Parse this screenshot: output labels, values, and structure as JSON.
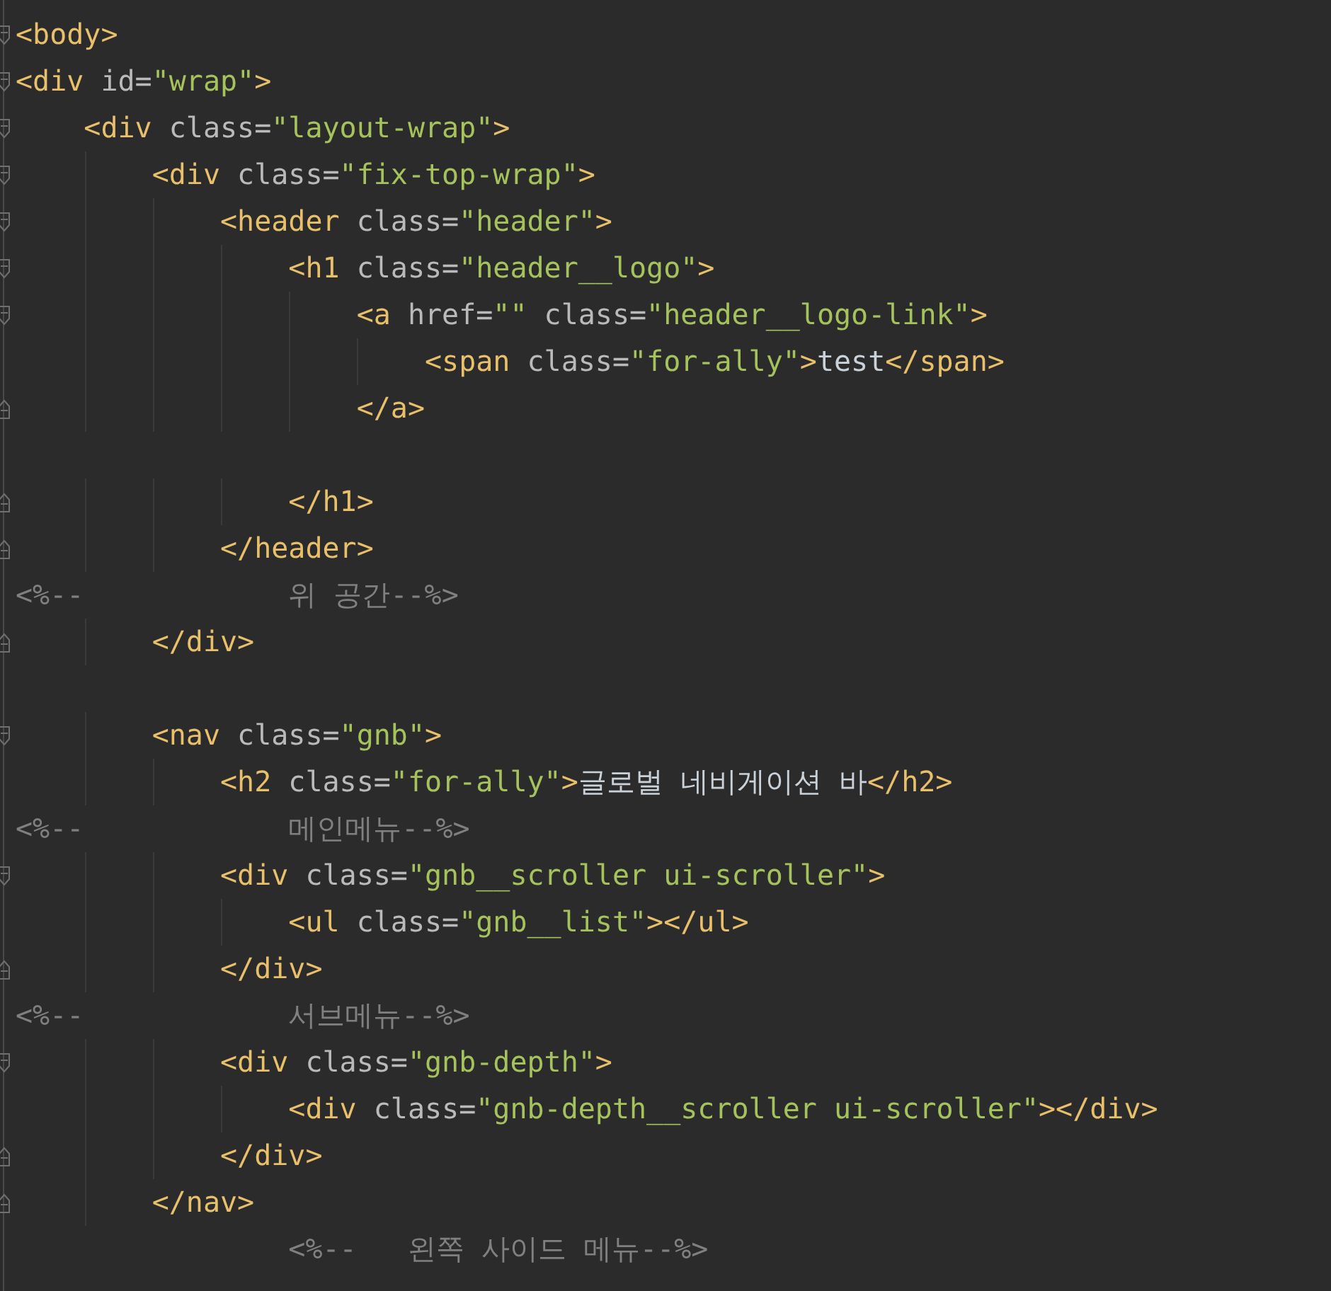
{
  "editor": {
    "lines": [
      {
        "kind": "opener",
        "segments": [
          {
            "kind": "tag",
            "text": "<body>"
          }
        ]
      },
      {
        "kind": "opener",
        "segments": [
          {
            "kind": "tag",
            "text": "<div"
          },
          {
            "kind": "attr",
            "text": " id="
          },
          {
            "kind": "string",
            "text": "\"wrap\""
          },
          {
            "kind": "tag",
            "text": ">"
          }
        ]
      },
      {
        "kind": "opener",
        "segments": [
          {
            "kind": "tag",
            "text": "    <div"
          },
          {
            "kind": "attr",
            "text": " class="
          },
          {
            "kind": "string",
            "text": "\"layout-wrap\""
          },
          {
            "kind": "tag",
            "text": ">"
          }
        ]
      },
      {
        "kind": "opener",
        "segments": [
          {
            "kind": "tag",
            "text": "        <div"
          },
          {
            "kind": "attr",
            "text": " class="
          },
          {
            "kind": "string",
            "text": "\"fix-top-wrap\""
          },
          {
            "kind": "tag",
            "text": ">"
          }
        ]
      },
      {
        "kind": "opener",
        "segments": [
          {
            "kind": "tag",
            "text": "            <header"
          },
          {
            "kind": "attr",
            "text": " class="
          },
          {
            "kind": "string",
            "text": "\"header\""
          },
          {
            "kind": "tag",
            "text": ">"
          }
        ]
      },
      {
        "kind": "opener",
        "segments": [
          {
            "kind": "tag",
            "text": "                <h1"
          },
          {
            "kind": "attr",
            "text": " class="
          },
          {
            "kind": "string",
            "text": "\"header__logo\""
          },
          {
            "kind": "tag",
            "text": ">"
          }
        ]
      },
      {
        "kind": "opener",
        "segments": [
          {
            "kind": "tag",
            "text": "                    <a"
          },
          {
            "kind": "attr",
            "text": " href="
          },
          {
            "kind": "string",
            "text": "\"\""
          },
          {
            "kind": "attr",
            "text": " class="
          },
          {
            "kind": "string",
            "text": "\"header__logo-link\""
          },
          {
            "kind": "tag",
            "text": ">"
          }
        ]
      },
      {
        "kind": "plain",
        "segments": [
          {
            "kind": "tag",
            "text": "                        <span"
          },
          {
            "kind": "attr",
            "text": " class="
          },
          {
            "kind": "string",
            "text": "\"for-ally\""
          },
          {
            "kind": "tag",
            "text": ">"
          },
          {
            "kind": "text",
            "text": "test"
          },
          {
            "kind": "tag",
            "text": "</span>"
          }
        ]
      },
      {
        "kind": "closer",
        "segments": [
          {
            "kind": "tag",
            "text": "                    </a>"
          }
        ]
      },
      {
        "kind": "blank"
      },
      {
        "kind": "closer",
        "segments": [
          {
            "kind": "tag",
            "text": "                </h1>"
          }
        ]
      },
      {
        "kind": "closer",
        "segments": [
          {
            "kind": "tag",
            "text": "            </header>"
          }
        ]
      },
      {
        "kind": "plain",
        "segments": [
          {
            "kind": "comment",
            "text": "<%--            위 공간--%>"
          }
        ]
      },
      {
        "kind": "closer",
        "segments": [
          {
            "kind": "tag",
            "text": "        </div>"
          }
        ]
      },
      {
        "kind": "blank"
      },
      {
        "kind": "opener",
        "segments": [
          {
            "kind": "tag",
            "text": "        <nav"
          },
          {
            "kind": "attr",
            "text": " class="
          },
          {
            "kind": "string",
            "text": "\"gnb\""
          },
          {
            "kind": "tag",
            "text": ">"
          }
        ]
      },
      {
        "kind": "plain",
        "segments": [
          {
            "kind": "tag",
            "text": "            <h2"
          },
          {
            "kind": "attr",
            "text": " class="
          },
          {
            "kind": "string",
            "text": "\"for-ally\""
          },
          {
            "kind": "tag",
            "text": ">"
          },
          {
            "kind": "text",
            "text": "글로벌 네비게이션 바"
          },
          {
            "kind": "tag",
            "text": "</h2>"
          }
        ]
      },
      {
        "kind": "plain",
        "segments": [
          {
            "kind": "comment",
            "text": "<%--            메인메뉴--%>"
          }
        ]
      },
      {
        "kind": "opener",
        "segments": [
          {
            "kind": "tag",
            "text": "            <div"
          },
          {
            "kind": "attr",
            "text": " class="
          },
          {
            "kind": "string",
            "text": "\"gnb__scroller ui-scroller\""
          },
          {
            "kind": "tag",
            "text": ">"
          }
        ]
      },
      {
        "kind": "plain",
        "segments": [
          {
            "kind": "tag",
            "text": "                <ul"
          },
          {
            "kind": "attr",
            "text": " class="
          },
          {
            "kind": "string",
            "text": "\"gnb__list\""
          },
          {
            "kind": "tag",
            "text": "></ul>"
          }
        ]
      },
      {
        "kind": "closer",
        "segments": [
          {
            "kind": "tag",
            "text": "            </div>"
          }
        ]
      },
      {
        "kind": "plain",
        "segments": [
          {
            "kind": "comment",
            "text": "<%--            서브메뉴--%>"
          }
        ]
      },
      {
        "kind": "opener",
        "segments": [
          {
            "kind": "tag",
            "text": "            <div"
          },
          {
            "kind": "attr",
            "text": " class="
          },
          {
            "kind": "string",
            "text": "\"gnb-depth\""
          },
          {
            "kind": "tag",
            "text": ">"
          }
        ]
      },
      {
        "kind": "plain",
        "segments": [
          {
            "kind": "tag",
            "text": "                <div"
          },
          {
            "kind": "attr",
            "text": " class="
          },
          {
            "kind": "string",
            "text": "\"gnb-depth__scroller ui-scroller\""
          },
          {
            "kind": "tag",
            "text": "></div>"
          }
        ]
      },
      {
        "kind": "closer",
        "segments": [
          {
            "kind": "tag",
            "text": "            </div>"
          }
        ]
      },
      {
        "kind": "closer",
        "segments": [
          {
            "kind": "tag",
            "text": "        </nav>"
          }
        ]
      },
      {
        "kind": "plain",
        "segments": [
          {
            "kind": "comment",
            "text": "                <%--   왼쪽 사이드 메뉴--%>"
          }
        ]
      }
    ]
  }
}
